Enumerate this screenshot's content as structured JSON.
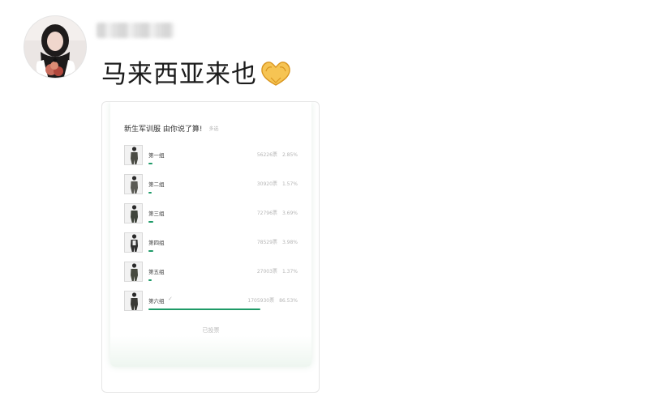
{
  "post": {
    "author_name": "",
    "message": "马来西亚来也",
    "emoji_icon": "heart-hands-icon"
  },
  "poll": {
    "title": "新生军训服 由你说了算!",
    "type": "多选",
    "status": "已投票",
    "accent_color": "#1e9a67",
    "options": [
      {
        "label": "第一组",
        "votes": "56226票",
        "percent": "2.85%",
        "fill": 0.0285,
        "voted": false
      },
      {
        "label": "第二组",
        "votes": "30920票",
        "percent": "1.57%",
        "fill": 0.0157,
        "voted": false
      },
      {
        "label": "第三组",
        "votes": "72796票",
        "percent": "3.69%",
        "fill": 0.0369,
        "voted": false
      },
      {
        "label": "第四组",
        "votes": "78529票",
        "percent": "3.98%",
        "fill": 0.0398,
        "voted": false
      },
      {
        "label": "第五组",
        "votes": "27003票",
        "percent": "1.37%",
        "fill": 0.0137,
        "voted": false
      },
      {
        "label": "第六组",
        "votes": "1705930票",
        "percent": "86.53%",
        "fill": 0.8653,
        "voted": true
      }
    ]
  },
  "next_post": {
    "icon": "back-arrow-icon",
    "text": ""
  }
}
